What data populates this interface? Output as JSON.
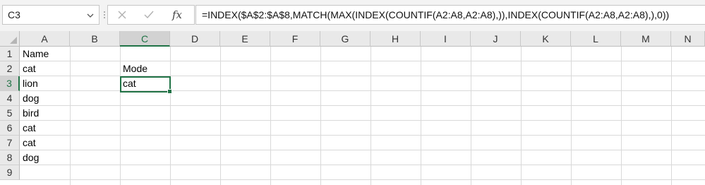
{
  "name_box": {
    "value": "C3"
  },
  "formula_bar": {
    "cancel_icon": "close-icon",
    "enter_icon": "check-icon",
    "function_label": "fx",
    "formula": "=INDEX($A$2:$A$8,MATCH(MAX(INDEX(COUNTIF(A2:A8,A2:A8),)),INDEX(COUNTIF(A2:A8,A2:A8),),0))"
  },
  "columns": [
    "A",
    "B",
    "C",
    "D",
    "E",
    "F",
    "G",
    "H",
    "I",
    "J",
    "K",
    "L",
    "M",
    "N"
  ],
  "rows": [
    "1",
    "2",
    "3",
    "4",
    "5",
    "6",
    "7",
    "8",
    "9"
  ],
  "selected_column": "C",
  "selected_row": "3",
  "cells": {
    "A1": "Name",
    "A2": "cat",
    "A3": "lion",
    "A4": "dog",
    "A5": "bird",
    "A6": "cat",
    "A7": "cat",
    "A8": "dog",
    "C2": "Mode",
    "C3": "cat"
  },
  "colors": {
    "accent": "#217346"
  }
}
